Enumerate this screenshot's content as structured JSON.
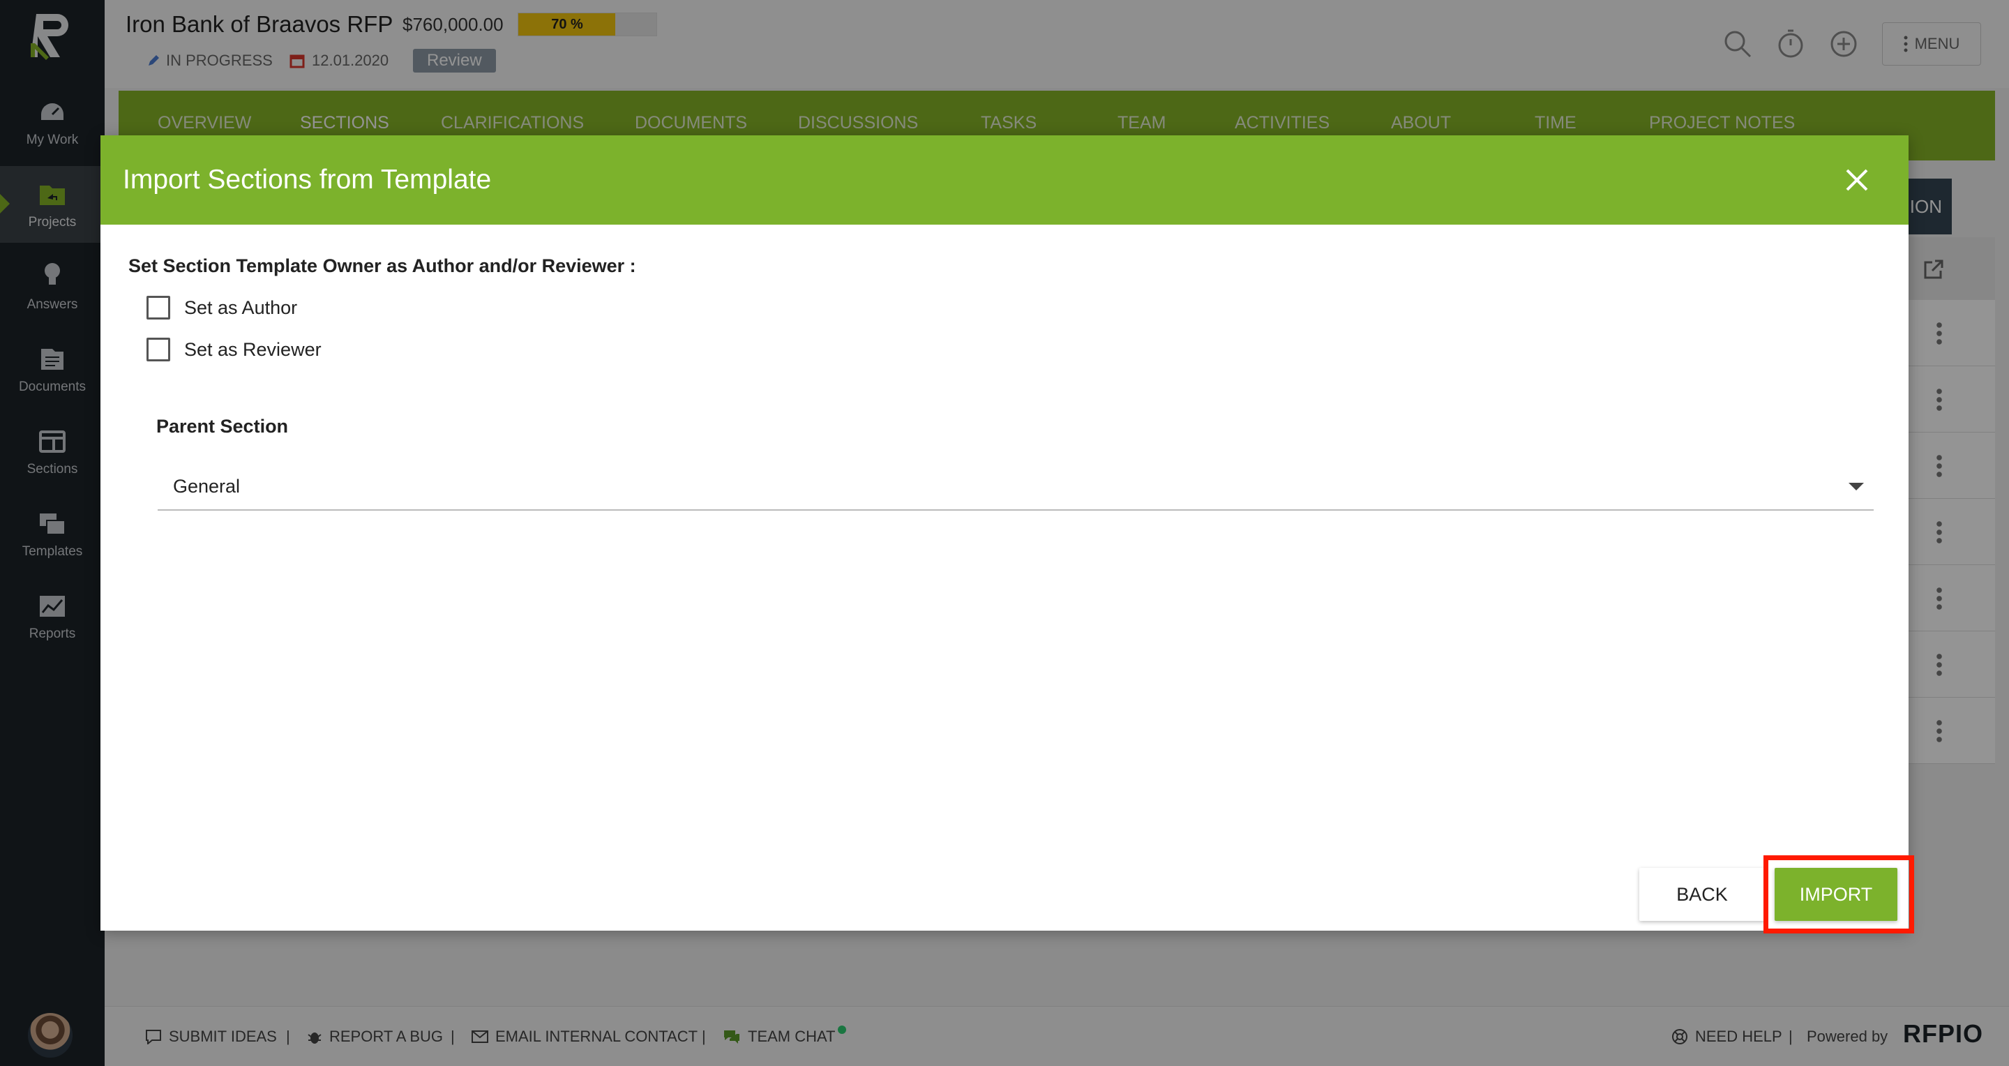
{
  "sidebar": {
    "items": [
      {
        "label": "My Work",
        "icon": "speedometer-icon"
      },
      {
        "label": "Projects",
        "icon": "folder-icon",
        "active": true
      },
      {
        "label": "Answers",
        "icon": "lightbulb-icon"
      },
      {
        "label": "Documents",
        "icon": "documents-icon"
      },
      {
        "label": "Sections",
        "icon": "sections-icon"
      },
      {
        "label": "Templates",
        "icon": "templates-icon"
      },
      {
        "label": "Reports",
        "icon": "reports-icon"
      }
    ]
  },
  "header": {
    "title": "Iron Bank of Braavos RFP",
    "amount": "$760,000.00",
    "progress": {
      "text": "70 %",
      "value": 0.7
    },
    "status": "IN PROGRESS",
    "date": "12.01.2020",
    "badge": "Review",
    "menu_label": "MENU"
  },
  "tabs": [
    "OVERVIEW",
    "SECTIONS",
    "CLARIFICATIONS",
    "DOCUMENTS",
    "DISCUSSIONS",
    "TASKS",
    "TEAM",
    "ACTIVITIES",
    "ABOUT",
    "TIME",
    "PROJECT NOTES"
  ],
  "background": {
    "partial_button": "ION"
  },
  "modal": {
    "title": "Import Sections from Template",
    "owner_label": "Set Section Template Owner as Author and/or Reviewer :",
    "checkbox_author": "Set as Author",
    "checkbox_reviewer": "Set as Reviewer",
    "parent_label": "Parent Section",
    "parent_value": "General",
    "back_label": "BACK",
    "import_label": "IMPORT"
  },
  "footer": {
    "submit_ideas": "SUBMIT IDEAS",
    "report_bug": "REPORT A BUG",
    "email_contact": "EMAIL INTERNAL CONTACT",
    "team_chat": "TEAM CHAT",
    "need_help": "NEED HELP",
    "powered_by": "Powered by",
    "brand": "RFPIO",
    "separator": "|"
  },
  "colors": {
    "brand_green": "#7cb22c",
    "sidebar": "#1d2329",
    "highlight": "#ff1a00",
    "progress": "#f1c40f"
  }
}
